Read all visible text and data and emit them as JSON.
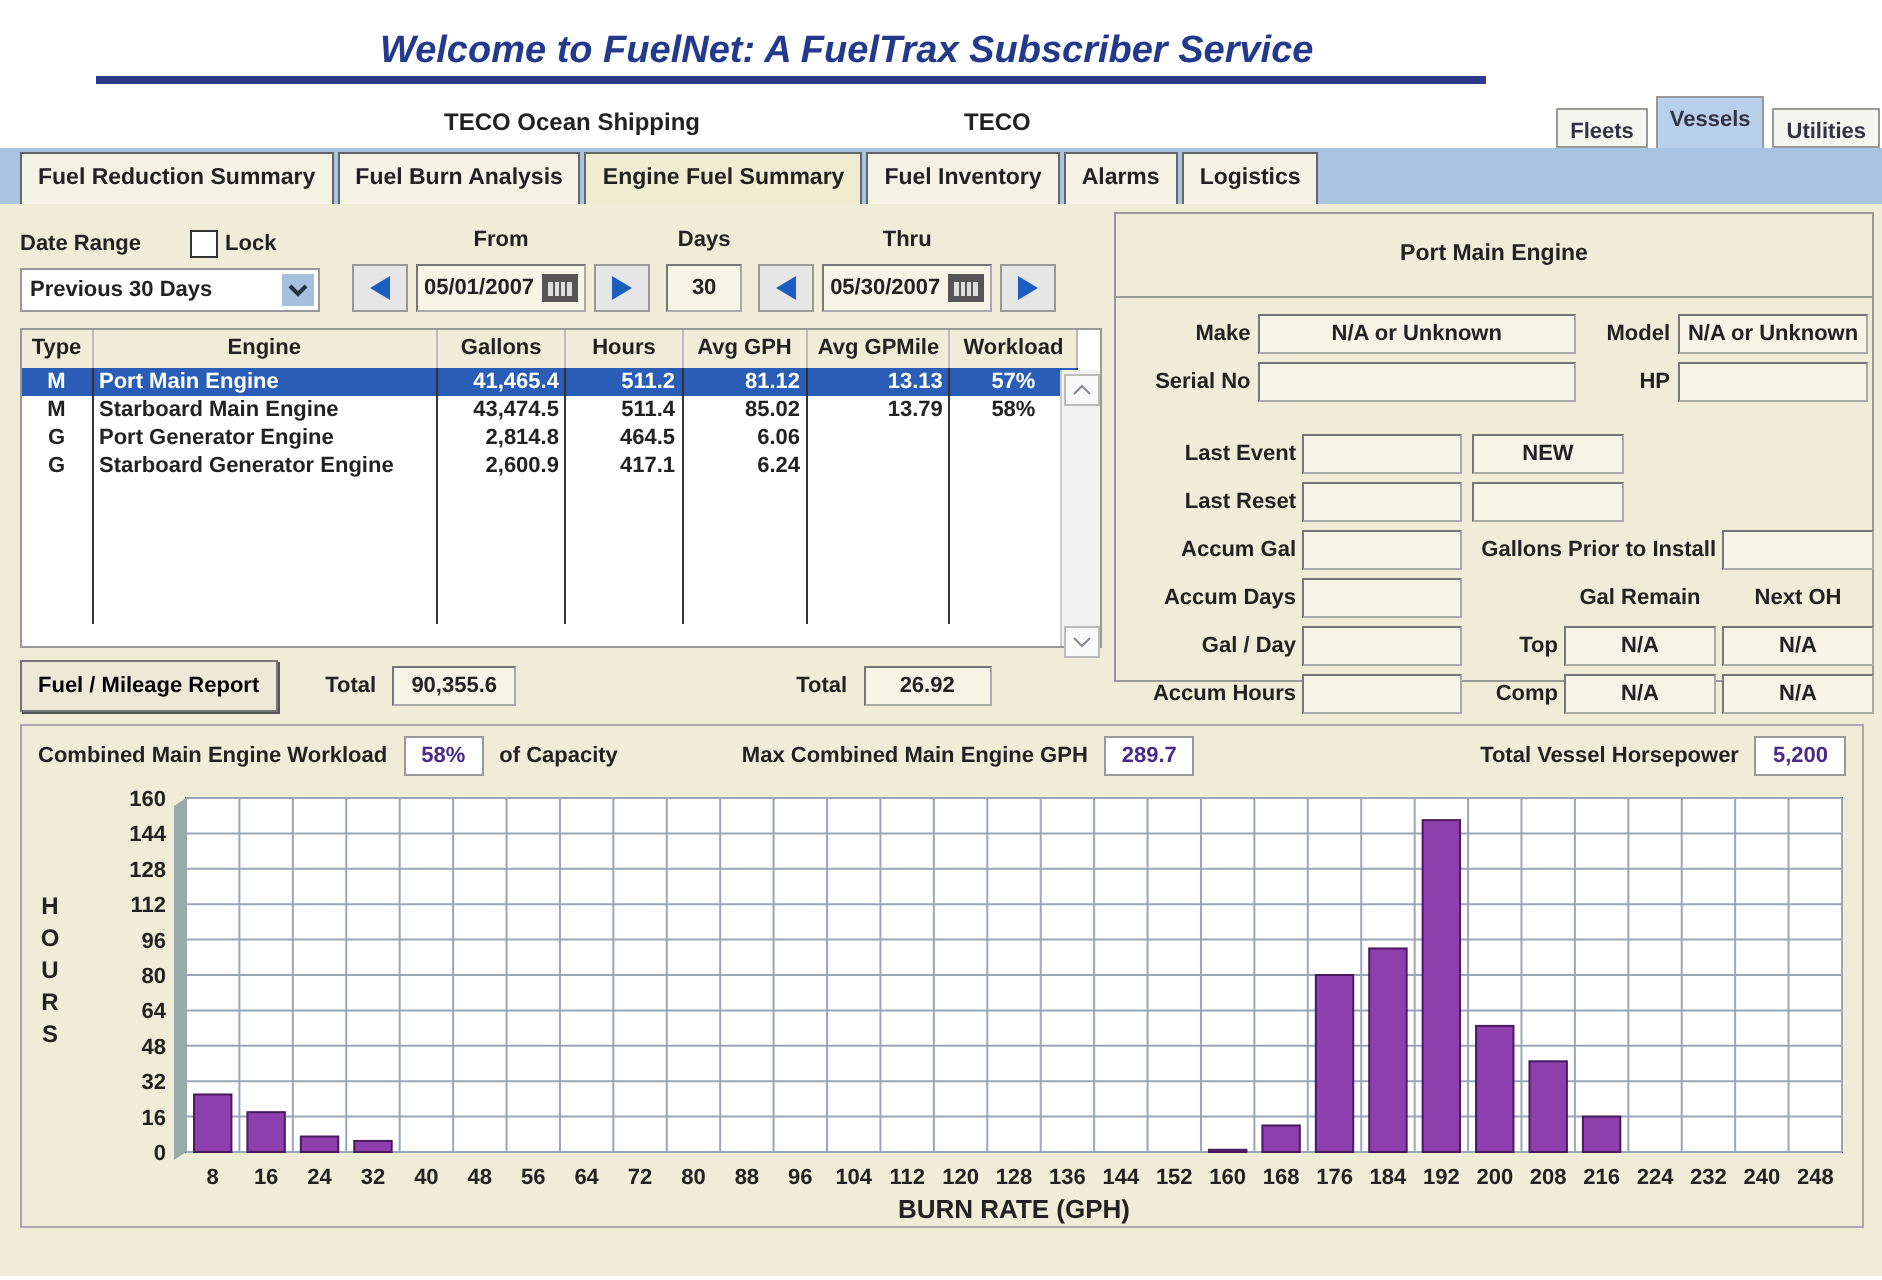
{
  "header": {
    "title": "Welcome to FuelNet:  A FuelTrax Subscriber Service",
    "company": "TECO Ocean Shipping",
    "code": "TECO"
  },
  "view_tabs": [
    {
      "label": "Fleets",
      "selected": false
    },
    {
      "label": "Vessels",
      "selected": true
    },
    {
      "label": "Utilities",
      "selected": false
    }
  ],
  "tabs": [
    {
      "label": "Fuel Reduction Summary",
      "selected": false
    },
    {
      "label": "Fuel Burn Analysis",
      "selected": false
    },
    {
      "label": "Engine Fuel Summary",
      "selected": true
    },
    {
      "label": "Fuel Inventory",
      "selected": false
    },
    {
      "label": "Alarms",
      "selected": false
    },
    {
      "label": "Logistics",
      "selected": false
    }
  ],
  "filters": {
    "date_range_label": "Date Range",
    "lock_label": "Lock",
    "lock_checked": false,
    "date_range": "Previous 30 Days",
    "from_label": "From",
    "from": "05/01/2007",
    "days_label": "Days",
    "days": "30",
    "thru_label": "Thru",
    "thru": "05/30/2007"
  },
  "table": {
    "columns": [
      "Type",
      "Engine",
      "Gallons",
      "Hours",
      "Avg GPH",
      "Avg GPMile",
      "Workload"
    ],
    "rows": [
      {
        "cells": [
          "M",
          "Port Main Engine",
          "41,465.4",
          "511.2",
          "81.12",
          "13.13",
          "57%"
        ],
        "selected": true
      },
      {
        "cells": [
          "M",
          "Starboard Main Engine",
          "43,474.5",
          "511.4",
          "85.02",
          "13.79",
          "58%"
        ],
        "selected": false
      },
      {
        "cells": [
          "G",
          "Port Generator Engine",
          "2,814.8",
          "464.5",
          "6.06",
          "",
          ""
        ],
        "selected": false
      },
      {
        "cells": [
          "G",
          "Starboard Generator Engine",
          "2,600.9",
          "417.1",
          "6.24",
          "",
          ""
        ],
        "selected": false
      }
    ]
  },
  "totals": {
    "report_button": "Fuel / Mileage Report",
    "gallons_label": "Total",
    "gallons": "90,355.6",
    "gpmile_label": "Total",
    "gpmile": "26.92"
  },
  "engine": {
    "title": "Port Main Engine",
    "make_label": "Make",
    "make": "N/A or Unknown",
    "model_label": "Model",
    "model": "N/A or Unknown",
    "serial_label": "Serial No",
    "hp_label": "HP",
    "rows": [
      {
        "label": "Last Event"
      },
      {
        "label": "Last Reset"
      },
      {
        "label": "Accum Gal"
      },
      {
        "label": "Accum Days"
      },
      {
        "label": "Gal / Day"
      },
      {
        "label": "Accum Hours"
      }
    ],
    "event_status": "NEW",
    "prior_label": "Gallons Prior to Install",
    "remain_label": "Gal Remain",
    "next_label": "Next OH",
    "overhaul": [
      {
        "label": "Top",
        "remain": "N/A",
        "next": "N/A"
      },
      {
        "label": "Comp",
        "remain": "N/A",
        "next": "N/A"
      }
    ]
  },
  "summary": {
    "workload_label": "Combined Main Engine Workload",
    "workload": "58%",
    "capacity_label": "of Capacity",
    "gph_label": "Max Combined Main Engine GPH",
    "gph": "289.7",
    "hp_label": "Total Vessel Horsepower",
    "hp": "5,200"
  },
  "chart_data": {
    "type": "bar",
    "grid": true,
    "xlabel": "BURN RATE (GPH)",
    "ylabel": "HOURS",
    "ylim": [
      0,
      160
    ],
    "yticks": [
      0,
      16,
      32,
      48,
      64,
      80,
      96,
      112,
      128,
      144,
      160
    ],
    "categories": [
      "8",
      "16",
      "24",
      "32",
      "40",
      "48",
      "56",
      "64",
      "72",
      "80",
      "88",
      "96",
      "104",
      "112",
      "120",
      "128",
      "136",
      "144",
      "152",
      "160",
      "168",
      "176",
      "184",
      "192",
      "200",
      "208",
      "216",
      "224",
      "232",
      "240",
      "248"
    ],
    "values": [
      26,
      18,
      7,
      5,
      0,
      0,
      0,
      0,
      0,
      0,
      0,
      0,
      0,
      0,
      0,
      0,
      0,
      0,
      0,
      1,
      12,
      80,
      92,
      150,
      57,
      41,
      16,
      0,
      0,
      0,
      0
    ]
  }
}
